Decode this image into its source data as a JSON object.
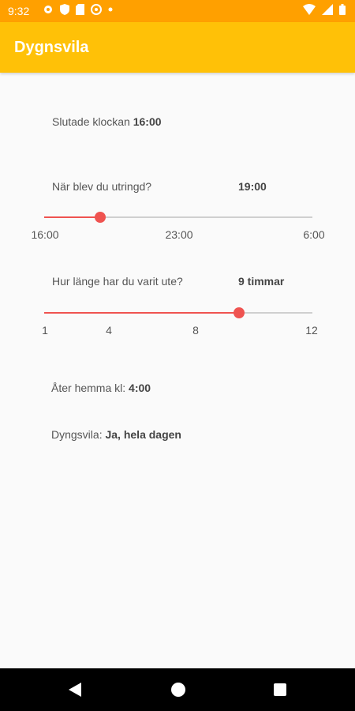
{
  "status_bar": {
    "time": "9:32",
    "icons_left": [
      "gear-icon",
      "shield-icon",
      "sim-card-icon",
      "app-icon",
      "dot-icon"
    ],
    "icons_right": [
      "wifi-icon",
      "signal-icon",
      "battery-icon"
    ]
  },
  "app_bar": {
    "title": "Dygnsvila"
  },
  "ended": {
    "label": "Slutade klockan",
    "value": "16:00"
  },
  "called_out": {
    "question": "När blev du utringd?",
    "value": "19:00",
    "slider": {
      "min_label": "16:00",
      "mid_label": "23:00",
      "max_label": "6:00",
      "level": 0.21
    }
  },
  "duration": {
    "question": "Hur länge har du varit ute?",
    "value": "9 timmar",
    "slider": {
      "ticks": [
        "1",
        "4",
        "8",
        "12"
      ],
      "min": 1,
      "max": 12,
      "current": 9
    }
  },
  "back_home": {
    "label": "Åter hemma kl:",
    "value": "4:00"
  },
  "rest": {
    "label": "Dyngsvila:",
    "value": "Ja, hela dagen"
  },
  "accent_color": "#FFC107",
  "status_bar_color": "#FFA000",
  "slider_color": "#ef5350",
  "nav_bar": {
    "buttons": [
      "back-icon",
      "home-icon",
      "recents-icon"
    ]
  }
}
